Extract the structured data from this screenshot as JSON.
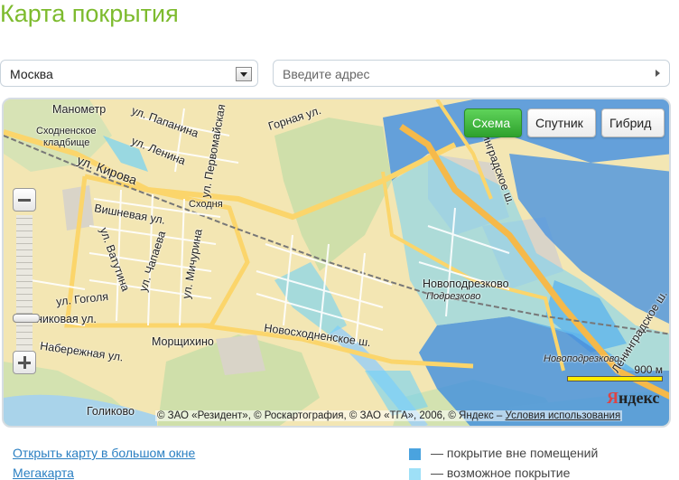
{
  "page": {
    "title": "Карта покрытия"
  },
  "city_select": {
    "value": "Москва"
  },
  "address": {
    "placeholder": "Введите адрес"
  },
  "map": {
    "type_buttons": [
      {
        "label": "Схема",
        "active": true
      },
      {
        "label": "Спутник",
        "active": false
      },
      {
        "label": "Гибрид",
        "active": false
      }
    ],
    "labels": {
      "manometr": "Манометр",
      "skhodnenskoe": "Сходненское",
      "kladbishche": "кладбище",
      "papanina": "ул. Папанина",
      "lenina": "ул. Ленина",
      "pervomayskaya": "ул. Первомайская",
      "gornaya": "Горная ул.",
      "kirova": "ул. Кирова",
      "shodnya": "Сходня",
      "vishnevaya": "Вишневая ул.",
      "vatutina": "ул. Ватутина",
      "chapaeva": "ул. Чапаева",
      "michurina": "ул. Мичурина",
      "gogolya": "ул. Гоголя",
      "nikovaya": "никовая ул.",
      "naberezhnaya": "Набережная ул.",
      "morshchikhino": "Морщихино",
      "novoskhodnenskoe": "Новосходненское ш.",
      "novopodrezkovo": "Новоподрезково",
      "podrezkovo": "Подрезково",
      "leningradskoe": "Ленинградское ш.",
      "novopodrezkovo_small": "Новоподрезково",
      "golikovo": "Голиково"
    },
    "scale": "900 м",
    "logo_first": "Я",
    "logo_rest": "ндекс",
    "copyright": "© ЗАО «Резидент», © Роскартография, © ЗАО «ТГА», 2006, © Яндекс –",
    "terms_link": "Условия использования"
  },
  "links": {
    "big_map": "Открыть карту в большом окне",
    "megakarta": "Мегакарта"
  },
  "legend": [
    {
      "label": "— покрытие вне помещений",
      "color": "#4aa3df"
    },
    {
      "label": "— возможное покрытие",
      "color": "#9ee0f7"
    }
  ],
  "colors": {
    "accent": "#7dbb2e",
    "link": "#2a7fc2"
  }
}
